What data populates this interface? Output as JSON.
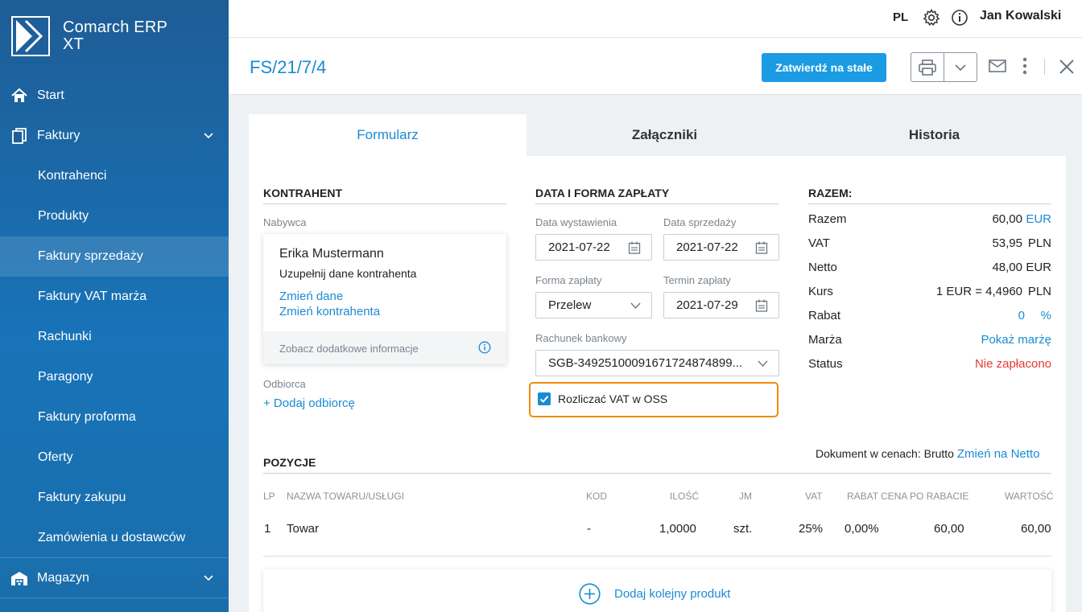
{
  "app": {
    "logo_line1": "Comarch ERP",
    "logo_line2": "XT"
  },
  "sidebar": {
    "items": [
      {
        "label": "Start",
        "icon": "home-icon"
      },
      {
        "label": "Faktury",
        "icon": "documents-icon"
      },
      {
        "label": "Kontrahenci"
      },
      {
        "label": "Produkty"
      },
      {
        "label": "Faktury sprzedaży"
      },
      {
        "label": "Faktury VAT marża"
      },
      {
        "label": "Rachunki"
      },
      {
        "label": "Paragony"
      },
      {
        "label": "Faktury proforma"
      },
      {
        "label": "Oferty"
      },
      {
        "label": "Faktury zakupu"
      },
      {
        "label": "Zamówienia u dostawców"
      },
      {
        "label": "Magazyn",
        "icon": "warehouse-icon"
      }
    ]
  },
  "topbar": {
    "lang": "PL",
    "user": "Jan Kowalski"
  },
  "document": {
    "number": "FS/21/7/4",
    "confirm_label": "Zatwierdź na stałe"
  },
  "tabs": [
    "Formularz",
    "Załączniki",
    "Historia"
  ],
  "contractor": {
    "section_title": "KONTRAHENT",
    "buyer_label": "Nabywca",
    "name": "Erika Mustermann",
    "hint": "Uzupełnij dane kontrahenta",
    "change_data": "Zmień dane",
    "change_contractor": "Zmień kontrahenta",
    "more_info": "Zobacz dodatkowe informacje",
    "recipient_label": "Odbiorca",
    "add_recipient": "+ Dodaj odbiorcę"
  },
  "payment": {
    "section_title": "DATA I FORMA ZAPŁATY",
    "issue_date_label": "Data wystawienia",
    "issue_date": "2021-07-22",
    "sale_date_label": "Data sprzedaży",
    "sale_date": "2021-07-22",
    "method_label": "Forma zapłaty",
    "method": "Przelew",
    "due_label": "Termin zapłaty",
    "due_date": "2021-07-29",
    "bank_label": "Rachunek bankowy",
    "bank_account": "SGB-34925100091671724874899...",
    "oss_label": "Rozliczać VAT w OSS",
    "oss_checked": true
  },
  "summary": {
    "section_title": "RAZEM:",
    "rows": [
      {
        "label": "Razem",
        "value": "60,00",
        "currency": "EUR"
      },
      {
        "label": "VAT",
        "value": "53,95",
        "currency": "PLN"
      },
      {
        "label": "Netto",
        "value": "48,00",
        "currency": "EUR"
      },
      {
        "label": "Kurs",
        "value": "1 EUR = 4,4960",
        "currency": "PLN"
      },
      {
        "label": "Rabat",
        "value": "0",
        "currency": "%"
      },
      {
        "label": "Marża",
        "value": "Pokaż marżę"
      },
      {
        "label": "Status",
        "value": "Nie zapłacono"
      }
    ]
  },
  "positions": {
    "section_title": "POZYCJE",
    "prices_label": "Dokument w cenach: Brutto",
    "switch_link": "Zmień na Netto",
    "headers": [
      "LP",
      "NAZWA TOWARU/USŁUGI",
      "KOD",
      "ILOŚĆ",
      "JM",
      "VAT",
      "RABAT",
      "CENA PO RABACIE",
      "WARTOŚĆ"
    ],
    "rows": [
      [
        "1",
        "Towar",
        "-",
        "1,0000",
        "szt.",
        "25%",
        "0,00%",
        "60,00",
        "60,00"
      ]
    ],
    "add_product": "Dodaj kolejny produkt"
  },
  "colors": {
    "accent": "#1a8bd2",
    "sidebar": "#1873b8",
    "highlight": "#f08a0c",
    "status_red": "#e53935"
  }
}
